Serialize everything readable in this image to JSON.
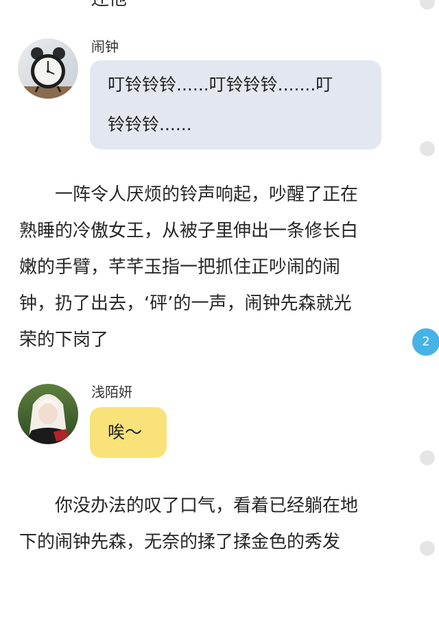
{
  "top_fragment": "还他",
  "messages": [
    {
      "sender": "闹钟",
      "bubble_lines": [
        "叮铃铃铃......叮铃铃铃.......叮",
        "铃铃铃......"
      ],
      "avatar_icon": "alarm-clock-icon"
    },
    {
      "sender": "浅陌妍",
      "bubble_lines": [
        "唉～"
      ],
      "avatar_icon": "girl-portrait"
    }
  ],
  "paragraphs": [
    {
      "lines": [
        "　　一阵令人厌烦的铃声响起，吵醒了正在",
        "熟睡的冷傲女王，从被子里伸出一条修长白",
        "嫩的手臂，芊芊玉指一把抓住正吵闹的闹",
        "钟，扔了出去，‘砰’的一声，闹钟先森就光",
        "荣的下岗了"
      ]
    },
    {
      "lines": [
        "　　你没办法的叹了口气，看着已经躺在地",
        "下的闹钟先森，无奈的揉了揉金色的秀发"
      ]
    }
  ],
  "comment_badge": "2",
  "colors": {
    "bubble_blue": "#e3e8f0",
    "bubble_yellow": "#fae27a",
    "badge": "#46b3e6",
    "side_dot": "#e5e5e5"
  }
}
